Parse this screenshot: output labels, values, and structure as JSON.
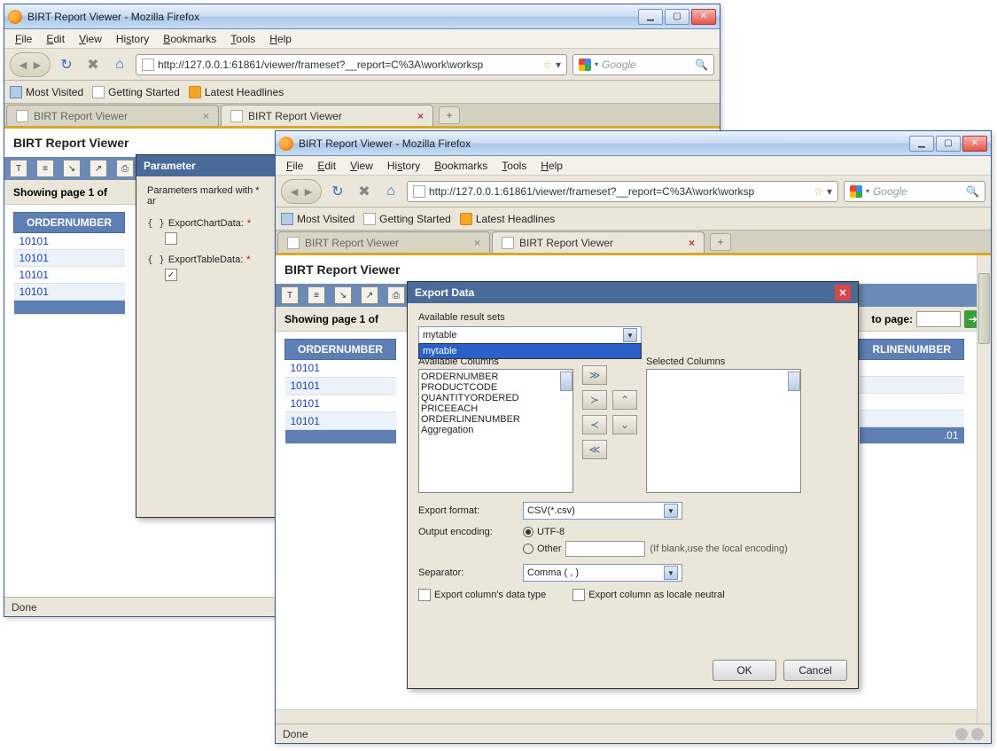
{
  "windows": {
    "back": {
      "title": "BIRT Report Viewer - Mozilla Firefox",
      "url": "http://127.0.0.1:61861/viewer/frameset?__report=C%3A\\work\\worksp",
      "tabs": [
        {
          "label": "BIRT Report Viewer",
          "active": false
        },
        {
          "label": "BIRT Report Viewer",
          "active": true
        }
      ],
      "report_title": "BIRT Report Viewer",
      "page_status": "Showing page 1 of",
      "table": {
        "header": "ORDERNUMBER",
        "rows": [
          "10101",
          "10101",
          "10101",
          "10101"
        ]
      },
      "param_dialog": {
        "title": "Parameter",
        "hint": "Parameters marked with * ar",
        "params": [
          {
            "name": "ExportChartData:",
            "required": true,
            "checked": false
          },
          {
            "name": "ExportTableData:",
            "required": true,
            "checked": true
          }
        ]
      },
      "status": "Done"
    },
    "front": {
      "title": "BIRT Report Viewer - Mozilla Firefox",
      "url": "http://127.0.0.1:61861/viewer/frameset?__report=C%3A\\work\\worksp",
      "tabs": [
        {
          "label": "BIRT Report Viewer",
          "active": false
        },
        {
          "label": "BIRT Report Viewer",
          "active": true
        }
      ],
      "report_title": "BIRT Report Viewer",
      "page_status": "Showing page 1 of",
      "goto_label": "to page:",
      "table": {
        "headers": [
          "ORDERNUMBER",
          "RLINENUMBER"
        ],
        "rows": [
          "10101",
          "10101",
          "10101",
          "10101"
        ],
        "partial_cell": ".01"
      },
      "export_dialog": {
        "title": "Export Data",
        "result_sets_label": "Available result sets",
        "result_set_value": "mytable",
        "dropdown_item": "mytable",
        "avail_cols_label": "Available Columns",
        "sel_cols_label": "Selected Columns",
        "avail_cols": [
          "ORDERNUMBER",
          "PRODUCTCODE",
          "QUANTITYORDERED",
          "PRICEEACH",
          "ORDERLINENUMBER",
          "Aggregation"
        ],
        "export_format_label": "Export format:",
        "export_format_value": "CSV(*.csv)",
        "encoding_label": "Output encoding:",
        "encoding_utf8": "UTF-8",
        "encoding_other": "Other",
        "encoding_hint": "(If blank,use the local encoding)",
        "separator_label": "Separator:",
        "separator_value": "Comma ( , )",
        "chk_datatype": "Export column's data type",
        "chk_locale": "Export column as locale neutral",
        "ok": "OK",
        "cancel": "Cancel"
      },
      "status": "Done"
    }
  },
  "menu": {
    "file": "File",
    "edit": "Edit",
    "view": "View",
    "history": "History",
    "bookmarks": "Bookmarks",
    "tools": "Tools",
    "help": "Help"
  },
  "bookmarks": {
    "most_visited": "Most Visited",
    "getting_started": "Getting Started",
    "latest_headlines": "Latest Headlines"
  },
  "search_placeholder": "Google"
}
